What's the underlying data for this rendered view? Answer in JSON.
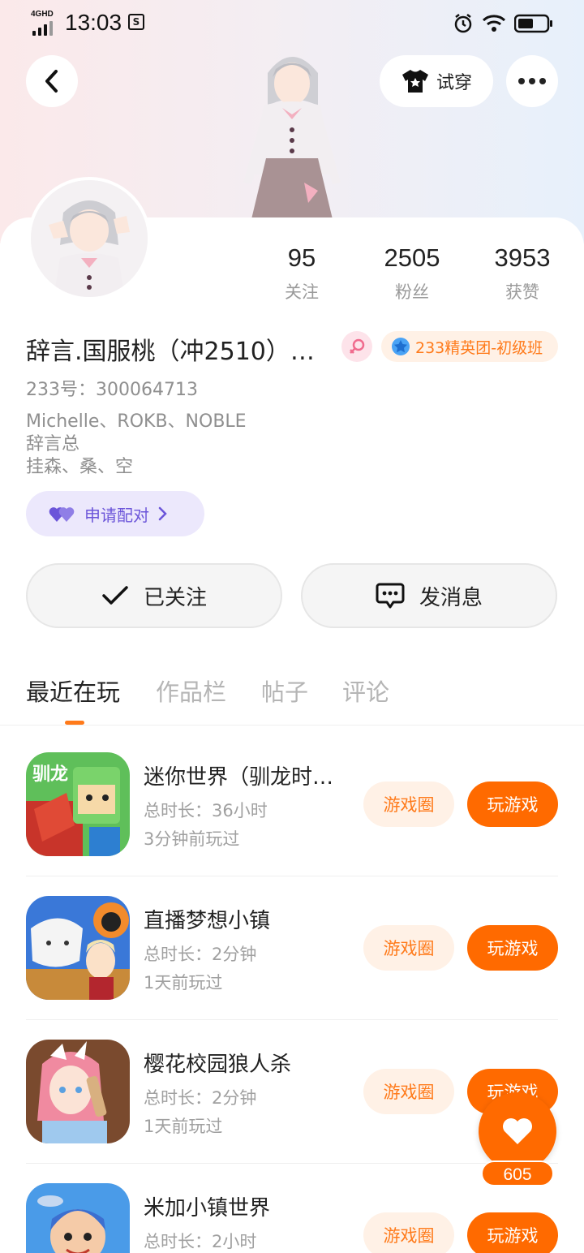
{
  "status_bar": {
    "network": "4GHD",
    "time": "13:03"
  },
  "top_actions": {
    "try_on_label": "试穿"
  },
  "stats": [
    {
      "value": "95",
      "label": "关注"
    },
    {
      "value": "2505",
      "label": "粉丝"
    },
    {
      "value": "3953",
      "label": "获赞"
    }
  ],
  "profile": {
    "nickname": "辞言.国服桃（冲2510）…",
    "rank_badge": "233精英团-初级班",
    "uid": "233号：300064713",
    "bio_lines": [
      "Michelle、ROKB、NOBLE",
      "辞言总",
      "挂森、桑、空"
    ],
    "pair_label": "申请配对"
  },
  "actions": {
    "follow_label": "已关注",
    "message_label": "发消息"
  },
  "tabs": [
    "最近在玩",
    "作品栏",
    "帖子",
    "评论"
  ],
  "games": [
    {
      "title": "迷你世界（驯龙时…",
      "duration": "总时长：36小时",
      "last_played": "3分钟前玩过",
      "circle_label": "游戏圈",
      "play_label": "玩游戏",
      "icon": "mini-world-icon"
    },
    {
      "title": "直播梦想小镇",
      "duration": "总时长：2分钟",
      "last_played": "1天前玩过",
      "circle_label": "游戏圈",
      "play_label": "玩游戏",
      "icon": "live-dream-town-icon"
    },
    {
      "title": "樱花校园狼人杀",
      "duration": "总时长：2分钟",
      "last_played": "1天前玩过",
      "circle_label": "游戏圈",
      "play_label": "玩游戏",
      "icon": "sakura-werewolf-icon"
    },
    {
      "title": "米加小镇世界",
      "duration": "总时长：2小时",
      "last_played": "",
      "circle_label": "游戏圈",
      "play_label": "玩游戏",
      "icon": "miga-town-icon"
    }
  ],
  "like_fab": {
    "count": "605"
  },
  "colors": {
    "accent": "#ff6a00",
    "accent_light": "#fff1e6",
    "pair_purple": "#6b55d9"
  }
}
